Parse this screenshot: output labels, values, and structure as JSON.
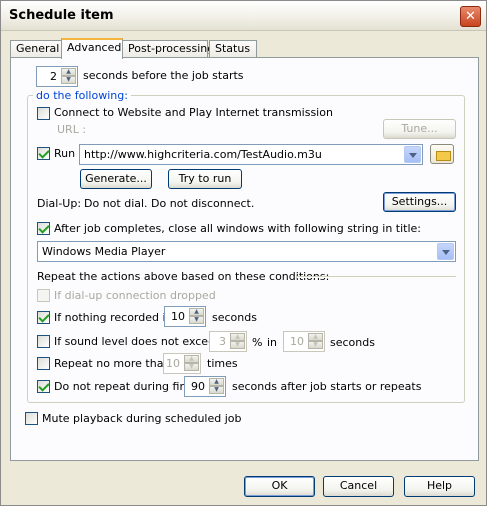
{
  "window": {
    "title": "Schedule item",
    "close_glyph": "✕"
  },
  "tabs": [
    {
      "label": "General"
    },
    {
      "label": "Advanced"
    },
    {
      "label": "Post-processing"
    },
    {
      "label": "Status"
    }
  ],
  "delay": {
    "value": "2",
    "label": "seconds before the job starts"
  },
  "group": {
    "legend": "do the following:"
  },
  "connect": {
    "label": "Connect to Website and Play Internet transmission",
    "checked": false
  },
  "url": {
    "label": "URL :",
    "tune_label": "Tune..."
  },
  "run": {
    "label": "Run",
    "checked": true,
    "value": "http://www.highcriteria.com/TestAudio.m3u",
    "generate_label": "Generate...",
    "try_label": "Try to run"
  },
  "dialup": {
    "label": "Dial-Up:",
    "value": "Do not dial. Do not disconnect.",
    "settings_label": "Settings..."
  },
  "close_windows": {
    "label": "After job completes, close all windows with following string in title:",
    "checked": true,
    "value": "Windows Media Player"
  },
  "repeat_header": "Repeat the actions above based on these conditions:",
  "conditions": {
    "dialup_dropped": {
      "label": "If dial-up connection dropped",
      "checked": false,
      "enabled": false
    },
    "nothing_recorded": {
      "label": "If nothing recorded in",
      "value": "10",
      "unit": "seconds",
      "checked": true
    },
    "sound_level": {
      "label": "If sound level does not exceed",
      "value": "3",
      "pct": "%",
      "in_label": "in",
      "seconds_value": "10",
      "unit": "seconds",
      "checked": false
    },
    "repeat_max": {
      "label": "Repeat no more than",
      "value": "10",
      "unit": "times",
      "checked": false
    },
    "no_repeat_first": {
      "label": "Do not repeat during first",
      "value": "90",
      "unit": "seconds after job starts or repeats",
      "checked": true
    }
  },
  "mute": {
    "label": "Mute playback during scheduled job",
    "checked": false
  },
  "footer": {
    "ok_label": "OK",
    "cancel_label": "Cancel",
    "help_label": "Help"
  },
  "icons": {
    "folder": "folder-open-icon",
    "close": "close-icon",
    "spin": "spin-arrows-icon",
    "dropdown": "chevron-down-icon"
  }
}
